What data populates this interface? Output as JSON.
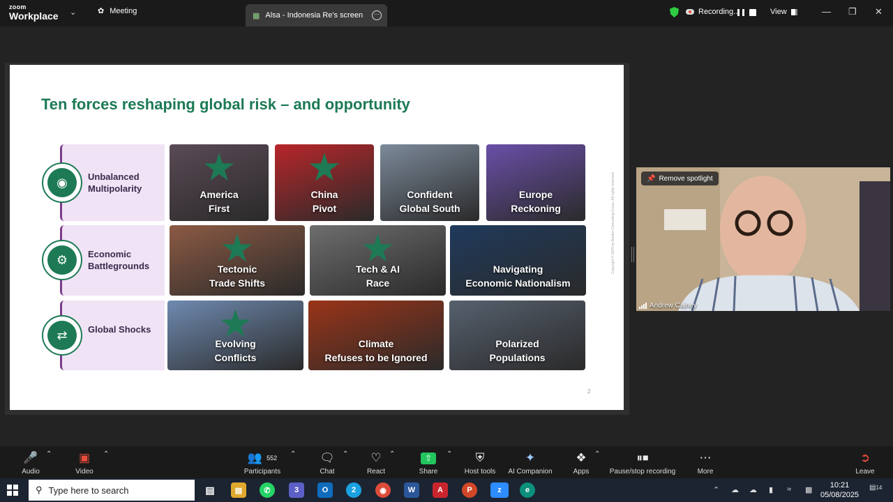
{
  "app": {
    "logo_line1": "zoom",
    "logo_line2": "Workplace",
    "meeting_tab": "Meeting",
    "screen_tab": "Alsa - Indonesia Re's screen",
    "recording": "Recording...",
    "view": "View"
  },
  "slide": {
    "title": "Ten forces reshaping global risk – and opportunity",
    "page_number": "2",
    "copyright": "Copyright © 2025 by Boston Consulting Group. All rights reserved.",
    "categories": [
      {
        "label": "Unbalanced Multipolarity",
        "icon": "globe-network-icon"
      },
      {
        "label": "Economic Battlegrounds",
        "icon": "gear-arrows-icon"
      },
      {
        "label": "Global Shocks",
        "icon": "people-exchange-icon"
      }
    ],
    "forces": [
      {
        "label": "America\nFirst",
        "starred": true,
        "color": "#5a4a55"
      },
      {
        "label": "China\nPivot",
        "starred": true,
        "color": "#b8262a"
      },
      {
        "label": "Confident\nGlobal South",
        "starred": false,
        "color": "#7c8a9a"
      },
      {
        "label": "Europe\nReckoning",
        "starred": false,
        "color": "#6a4fa8"
      },
      {
        "label": "Tectonic\nTrade Shifts",
        "starred": true,
        "color": "#8c5a44"
      },
      {
        "label": "Tech & AI\nRace",
        "starred": true,
        "color": "#6e6e6e"
      },
      {
        "label": "Navigating\nEconomic Nationalism",
        "starred": false,
        "color": "#1f3a5c"
      },
      {
        "label": "Evolving\nConflicts",
        "starred": true,
        "color": "#6f8ab0"
      },
      {
        "label": "Climate\nRefuses to be Ignored",
        "starred": false,
        "color": "#9a3418"
      },
      {
        "label": "Polarized\nPopulations",
        "starred": false,
        "color": "#56606e"
      }
    ]
  },
  "video": {
    "spotlight": "Remove spotlight",
    "participant_name": "Andrew Cainey"
  },
  "toolbar": {
    "audio": "Audio",
    "video": "Video",
    "participants": "Participants",
    "participants_count": "552",
    "chat": "Chat",
    "react": "React",
    "share": "Share",
    "host_tools": "Host tools",
    "ai_companion": "AI Companion",
    "apps": "Apps",
    "pause_stop": "Pause/stop recording",
    "more": "More",
    "leave": "Leave"
  },
  "taskbar": {
    "search_placeholder": "Type here to search",
    "time": "10:21",
    "date": "05/08/2025",
    "notification_count": "14",
    "teams_badge": "3",
    "edge_badge": "2"
  },
  "colors": {
    "slide_green": "#1d7a55",
    "category_bg": "#f0e3f5",
    "accent_purple": "#7a3c8a",
    "share_green": "#22c55e"
  }
}
